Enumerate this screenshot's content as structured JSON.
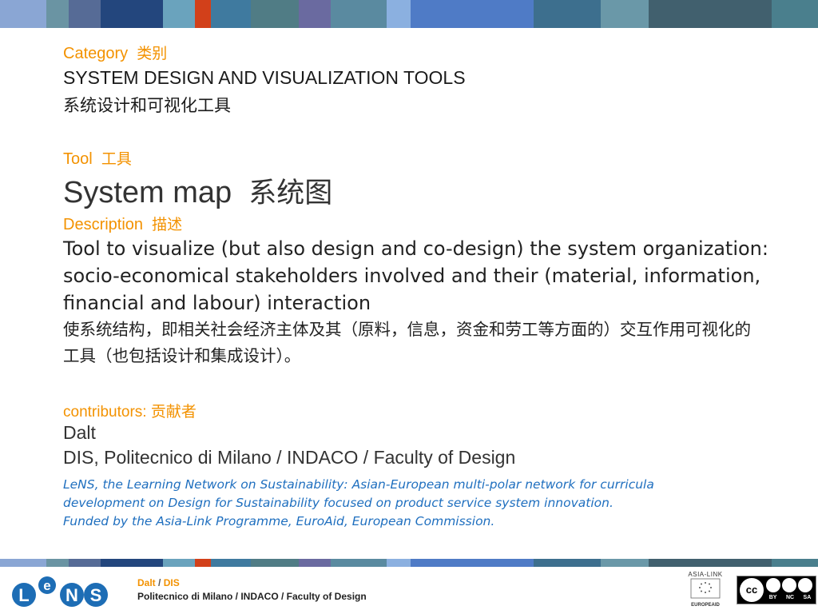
{
  "top_band_colors": [
    "#8aa6d4",
    "#6a94a3",
    "#566b96",
    "#23467d",
    "#6aa3bd",
    "#d2401a",
    "#3f7a9f",
    "#507c85",
    "#6a6aa0",
    "#5a8aa0",
    "#8bb0e0",
    "#4f7bc6",
    "#3d6f8e",
    "#6a98a8",
    "#41606e",
    "#4a7f8d"
  ],
  "category": {
    "label_en": "Category",
    "label_cn": "类别",
    "title_en": "SYSTEM DESIGN AND VISUALIZATION TOOLS",
    "title_cn": "系统设计和可视化工具"
  },
  "tool": {
    "label_en": "Tool",
    "label_cn": "工具",
    "title_en": "System map",
    "title_cn": "系统图"
  },
  "description": {
    "label_en": "Description",
    "label_cn": "描述",
    "text_en": "Tool to visualize (but also design and co-design) the system organization: socio-economical stakeholders involved and their (material, information, financial and labour) interaction",
    "text_cn": "使系统结构，即相关社会经济主体及其（原料，信息，资金和劳工等方面的）交互作用可视化的工具（也包括设计和集成设计）。"
  },
  "contributors": {
    "label": "contributors:",
    "label_cn": "贡献者",
    "name": "Dalt",
    "affiliation": "DIS, Politecnico di Milano / INDACO / Faculty of Design"
  },
  "project_note": {
    "line1": "LeNS, the Learning Network on Sustainability: Asian-European multi-polar network for curricula",
    "line2": "development on Design for Sustainability focused on product service system innovation.",
    "line3": "Funded by the Asia-Link Programme, EuroAid, European Commission."
  },
  "footer": {
    "author": "Dalt",
    "separator": " / ",
    "dept": "DIS",
    "affiliation": "Politecnico di Milano / INDACO / Faculty of Design",
    "logo_letters": [
      "L",
      "e",
      "N",
      "S"
    ],
    "asia_link_text": "ASIA-LINK",
    "europeaid_text": "EUROPEAID",
    "cc_badges": [
      "BY",
      "NC",
      "SA"
    ]
  },
  "colors": {
    "accent": "#f39200",
    "link_blue": "#1f6fbf",
    "logo_blue": "#1d6db5"
  }
}
